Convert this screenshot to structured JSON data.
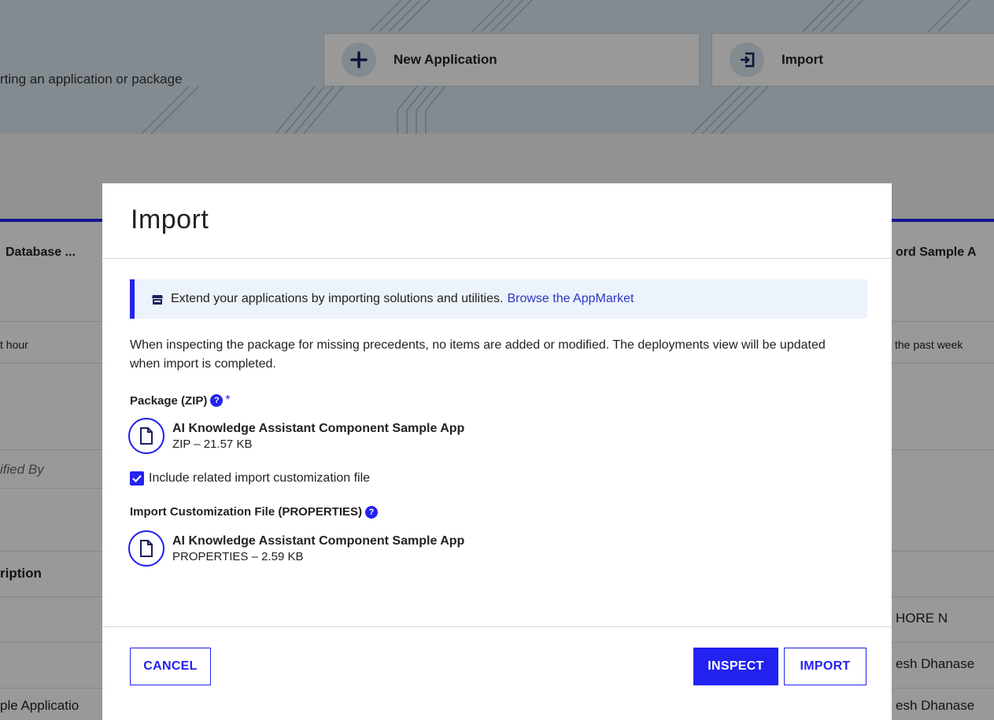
{
  "background": {
    "header_subtitle": "rting an application or package",
    "new_app_label": "New Application",
    "import_card_label": "Import",
    "left_column": {
      "header": "Database ...",
      "time": "t hour",
      "modified_by": "ified By",
      "description": "ription",
      "row_app": "ple Applicatio"
    },
    "right_column": {
      "header": "ord Sample A",
      "time": "the past week",
      "row1": "HORE N",
      "row2": "esh Dhanase",
      "row3": "esh Dhanase"
    }
  },
  "modal": {
    "title": "Import",
    "banner": {
      "icon": "store-icon",
      "text": "Extend your applications by importing solutions and utilities.",
      "link": "Browse the AppMarket"
    },
    "description": "When inspecting the package for missing precedents, no items are added or modified. The deployments view will be updated when import is completed.",
    "package": {
      "label": "Package (ZIP)",
      "required_mark": "*",
      "file_name": "AI Knowledge Assistant Component Sample App",
      "file_meta": "ZIP – 21.57 KB"
    },
    "include_checkbox": {
      "checked": true,
      "label": "Include related import customization file"
    },
    "customization": {
      "label": "Import Customization File (PROPERTIES)",
      "file_name": "AI Knowledge Assistant Component Sample App",
      "file_meta": "PROPERTIES – 2.59 KB"
    },
    "buttons": {
      "cancel": "CANCEL",
      "inspect": "INSPECT",
      "import": "IMPORT"
    }
  },
  "colors": {
    "accent": "#2322f0",
    "banner_bg": "#edf3fb",
    "link": "#2b38c6"
  }
}
